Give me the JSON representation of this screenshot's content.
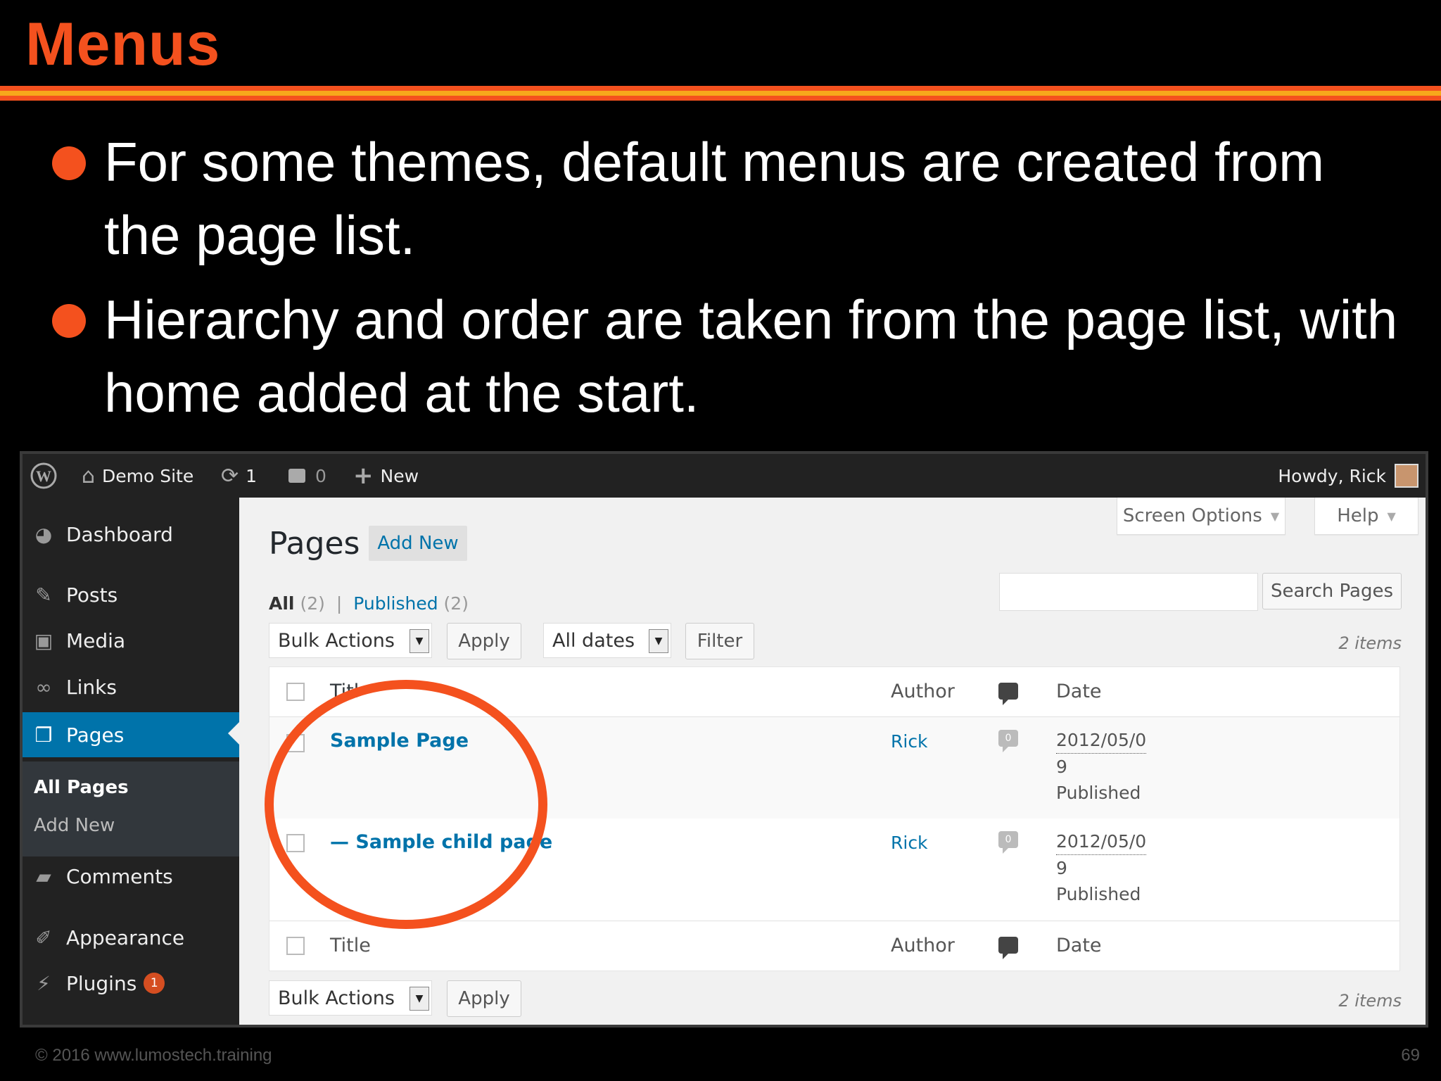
{
  "slide": {
    "title": "Menus",
    "bullets": [
      "For some themes, default menus are created from the page list.",
      "Hierarchy and order are taken from the page list, with home added at the start."
    ],
    "footer_left": "© 2016  www.lumostech.training",
    "page_number": "69",
    "colors": {
      "accent": "#f4511e",
      "stripe1": "#f4511e",
      "stripe2": "#f7a81b",
      "stripe3": "#f4511e"
    }
  },
  "adminbar": {
    "site_name": "Demo Site",
    "updates_count": "1",
    "comments_count": "0",
    "new_label": "New",
    "howdy": "Howdy, Rick",
    "icons": [
      "wordpress-logo-icon",
      "home-icon",
      "updates-icon",
      "comment-icon",
      "plus-icon"
    ]
  },
  "sidebar": {
    "items": [
      {
        "label": "Dashboard",
        "icon": "dashboard-icon"
      },
      {
        "label": "Posts",
        "icon": "pin-icon"
      },
      {
        "label": "Media",
        "icon": "media-icon"
      },
      {
        "label": "Links",
        "icon": "link-icon"
      },
      {
        "label": "Pages",
        "icon": "pages-icon"
      },
      {
        "label": "Comments",
        "icon": "comment-icon"
      },
      {
        "label": "Appearance",
        "icon": "brush-icon"
      },
      {
        "label": "Plugins",
        "icon": "plug-icon",
        "badge": "1"
      }
    ],
    "submenu": [
      "All Pages",
      "Add New"
    ]
  },
  "content": {
    "screen_options": "Screen Options",
    "help": "Help",
    "page_title": "Pages",
    "add_new": "Add New",
    "filter_all": "All",
    "filter_all_count": "(2)",
    "filter_sep": "|",
    "filter_published": "Published",
    "filter_published_count": "(2)",
    "search_button": "Search Pages",
    "search_value": "",
    "bulk_actions": "Bulk Actions",
    "apply": "Apply",
    "all_dates": "All dates",
    "filter_button": "Filter",
    "items_count": "2 items",
    "columns": {
      "title": "Title",
      "title_partial": "Titl",
      "author": "Author",
      "date": "Date"
    },
    "rows": [
      {
        "title": "Sample Page",
        "author": "Rick",
        "comments": "0",
        "date_line1": "2012/05/0",
        "date_line2": "9",
        "status": "Published"
      },
      {
        "title": "— Sample child page",
        "author": "Rick",
        "comments": "0",
        "date_line1": "2012/05/0",
        "date_line2": "9",
        "status": "Published"
      }
    ]
  }
}
